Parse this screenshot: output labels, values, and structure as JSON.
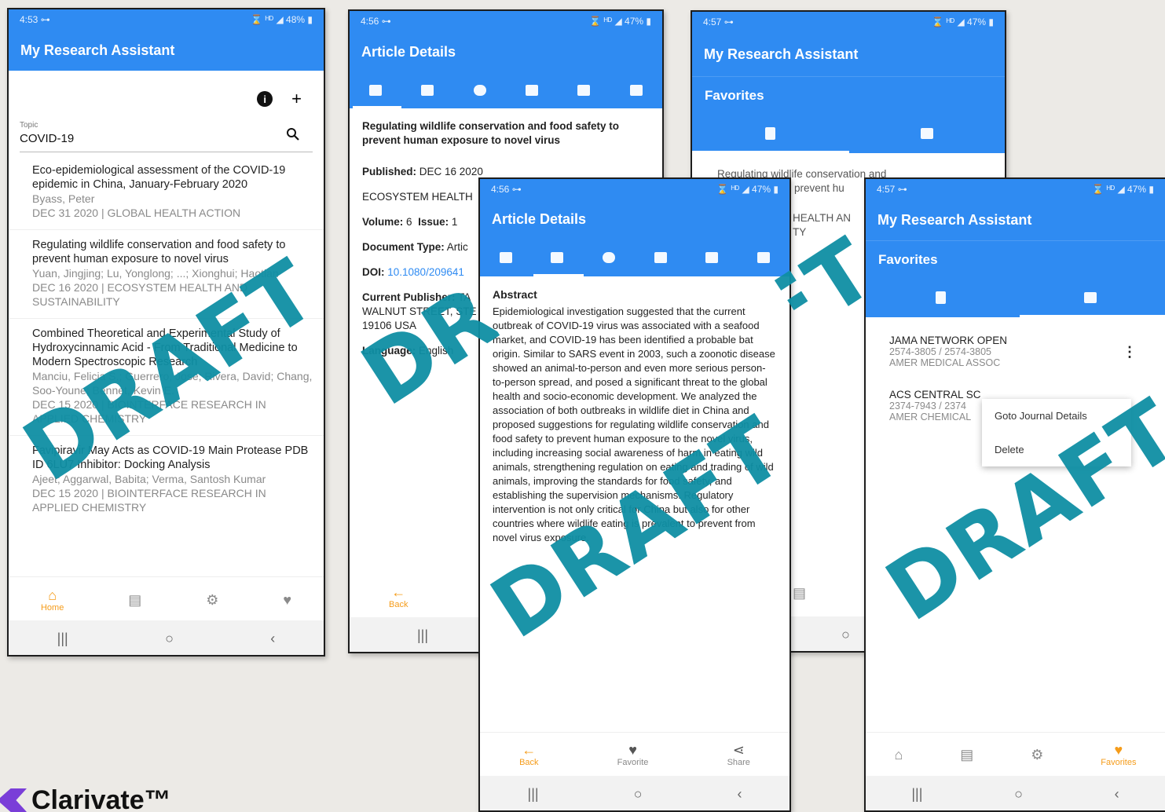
{
  "phones": {
    "home": {
      "status": {
        "time": "4:53 ⊶",
        "right": "⌛ ᴴᴰ ◢ 48% ▮"
      },
      "title": "My Research Assistant",
      "topic_label": "Topic",
      "topic_value": "COVID-19",
      "articles": [
        {
          "title": "Eco-epidemiological assessment of the COVID-19 epidemic in China, January-February 2020",
          "authors": "Byass, Peter",
          "meta": "DEC 31 2020 | GLOBAL HEALTH ACTION"
        },
        {
          "title": "Regulating wildlife conservation and food safety to prevent human exposure to novel virus",
          "authors": "Yuan, Jingjing; Lu, Yonglong; ...; Xionghui; Haotian",
          "meta": "DEC 16 2020 | ECOSYSTEM HEALTH AND SUSTAINABILITY"
        },
        {
          "title": "Combined Theoretical and Experimental Study of Hydroxycinnamic Acid - From Traditional Medicine to Modern Spectroscopic Research",
          "authors": "Manciu, Felicia S.; Guerrero, Jose; Rivera, David; Chang, Soo-Youne; Bennet, Kevin E.",
          "meta": "DEC 15 2020 | BIOINTERFACE RESEARCH IN APPLIED CHEMISTRY"
        },
        {
          "title": "Favipiravir May Acts as COVID-19 Main Protease PDB ID 6LU7 Inhibitor: Docking Analysis",
          "authors": "Ajeet; Aggarwal, Babita; Verma, Santosh Kumar",
          "meta": "DEC 15 2020 | BIOINTERFACE RESEARCH IN APPLIED CHEMISTRY"
        }
      ],
      "nav_home": "Home"
    },
    "details": {
      "status": {
        "time": "4:56 ⊶",
        "right": "⌛ ᴴᴰ ◢ 47% ▮"
      },
      "title": "Article Details",
      "article_title": "Regulating wildlife conservation and food safety to prevent human exposure to novel virus",
      "published_label": "Published:",
      "published": "DEC 16 2020",
      "journal": "ECOSYSTEM HEALTH",
      "volume_label": "Volume:",
      "volume": "6",
      "issue_label": "Issue:",
      "issue": "1",
      "doctype_label": "Document Type:",
      "doctype": "Artic",
      "doi_label": "DOI:",
      "doi": "10.1080/209641",
      "publisher_label": "Current Publisher:",
      "publisher": "TA",
      "publisher_addr1": "WALNUT STREET, STE",
      "publisher_addr2": "19106 USA",
      "language_label": "Language:",
      "language": "English",
      "back": "Back"
    },
    "favorites_a": {
      "status": {
        "time": "4:57 ⊶",
        "right": "⌛ ᴴᴰ ◢ 47% ▮"
      },
      "title": "My Research Assistant",
      "section": "Favorites",
      "item_line1": "Regulating wildlife conservation and",
      "item_line2": "prevent hu",
      "item_line3": "HEALTH AN",
      "item_line4": "TY"
    },
    "abstract": {
      "status": {
        "time": "4:56 ⊶",
        "right": "⌛ ᴴᴰ ◢ 47% ▮"
      },
      "title": "Article Details",
      "heading": "Abstract",
      "text": "Epidemiological investigation suggested that the current outbreak of COVID-19 virus was associated with a seafood market, and COVID-19 has been identified a probable bat origin. Similar to SARS event in 2003, such a zoonotic disease showed an animal-to-person and even more serious person-to-person spread, and posed a significant threat to the global health and socio-economic development. We analyzed the association of both outbreaks in wildlife diet in China and proposed suggestions for regulating wildlife conservation and food safety to prevent human exposure to the novel virus, including increasing social awareness of harm in eating wild animals, strengthening regulation on eating and trading of wild animals, improving the standards for food safety, and establishing the supervision mechanisms. Regulatory intervention is not only critical for China but also for other countries where wildlife eating is prevalent to prevent from novel virus exposure.",
      "back": "Back",
      "favorite": "Favorite",
      "share": "Share"
    },
    "favorites_b": {
      "status": {
        "time": "4:57 ⊶",
        "right": "⌛ ᴴᴰ ◢ 47% ▮"
      },
      "title": "My Research Assistant",
      "section": "Favorites",
      "journals": [
        {
          "name": "JAMA NETWORK OPEN",
          "issn": "2574-3805 / 2574-3805",
          "publisher": "AMER MEDICAL ASSOC"
        },
        {
          "name": "ACS CENTRAL SC",
          "issn": "2374-7943 / 2374",
          "publisher": "AMER CHEMICAL"
        }
      ],
      "menu_goto": "Goto Journal Details",
      "menu_delete": "Delete",
      "nav_favorites": "Favorites"
    }
  },
  "watermark": "DRAFT",
  "logo": {
    "name": "Clarivate",
    "tm": "™",
    "visible": "Clarivate™"
  },
  "colors": {
    "primary": "#2f8bf2",
    "accent": "#f59c1a",
    "watermark": "#0f8fa4"
  }
}
